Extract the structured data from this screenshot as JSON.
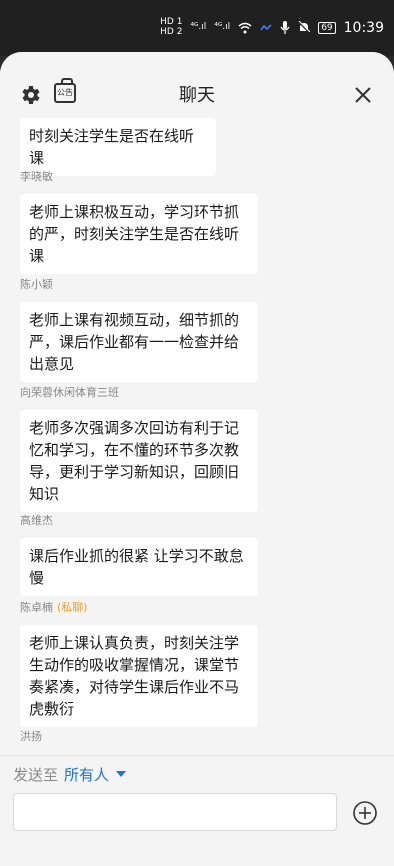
{
  "status_bar": {
    "hd1": "HD 1",
    "hd2": "HD 2",
    "signal1": "⁴ᴳ.ıl",
    "signal2": "⁴ᴳ.ıl",
    "battery": "69",
    "time": "10:39"
  },
  "header": {
    "title": "聊天",
    "notice_label": "公告"
  },
  "messages": [
    {
      "sender": "",
      "private": "",
      "text": "时刻关注学生是否在线听课"
    },
    {
      "sender": "李晓敏",
      "private": "",
      "text": "老师上课积极互动，学习环节抓的严，时刻关注学生是否在线听课"
    },
    {
      "sender": "陈小颖",
      "private": "",
      "text": "老师上课有视频互动，细节抓的严，课后作业都有一一检查并给出意见"
    },
    {
      "sender": "向荣蓉休闲体育三班",
      "private": "",
      "text": "老师多次强调多次回访有利于记忆和学习，在不懂的环节多次教导，更利于学习新知识，回顾旧知识"
    },
    {
      "sender": "高维杰",
      "private": "",
      "text": "课后作业抓的很紧 让学习不敢怠慢"
    },
    {
      "sender": "陈卓楠",
      "private": "(私聊)",
      "text": "老师上课认真负责，时刻关注学生动作的吸收掌握情况，课堂节奏紧凑，对待学生课后作业不马虎敷衍"
    },
    {
      "sender": "洪扬",
      "private": "",
      "text": ""
    }
  ],
  "composer": {
    "send_to_label": "发送至",
    "recipient": "所有人",
    "input_value": "",
    "input_placeholder": ""
  }
}
